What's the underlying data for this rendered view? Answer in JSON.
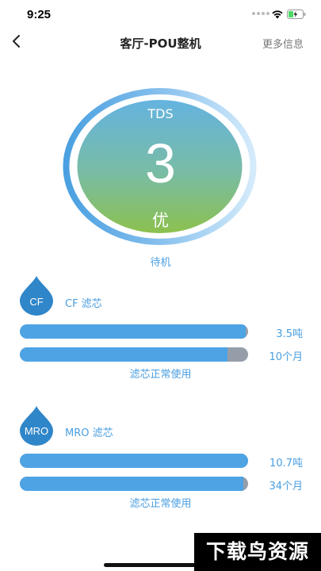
{
  "status_bar": {
    "time": "9:25"
  },
  "nav": {
    "title": "客厅-POU整机",
    "more_info": "更多信息"
  },
  "tds": {
    "label": "TDS",
    "value": "3",
    "grade": "优",
    "state": "待机"
  },
  "filters": [
    {
      "badge": "CF",
      "name": "CF 滤芯",
      "volume_text": "3.5吨",
      "volume_remaining_fraction": 0.99,
      "time_text": "10个月",
      "time_remaining_fraction": 0.91,
      "status": "滤芯正常使用"
    },
    {
      "badge": "MRO",
      "name": "MRO 滤芯",
      "volume_text": "10.7吨",
      "volume_remaining_fraction": 1.0,
      "time_text": "34个月",
      "time_remaining_fraction": 0.98,
      "status": "滤芯正常使用"
    }
  ],
  "watermark": "下载鸟资源",
  "colors": {
    "accent": "#4da3e4",
    "track": "#959ea8",
    "gauge_top": "#64b3e0",
    "gauge_bottom": "#8cc14e",
    "ring_light": "#d4ebfb",
    "ring_dark": "#4aa0e0"
  }
}
